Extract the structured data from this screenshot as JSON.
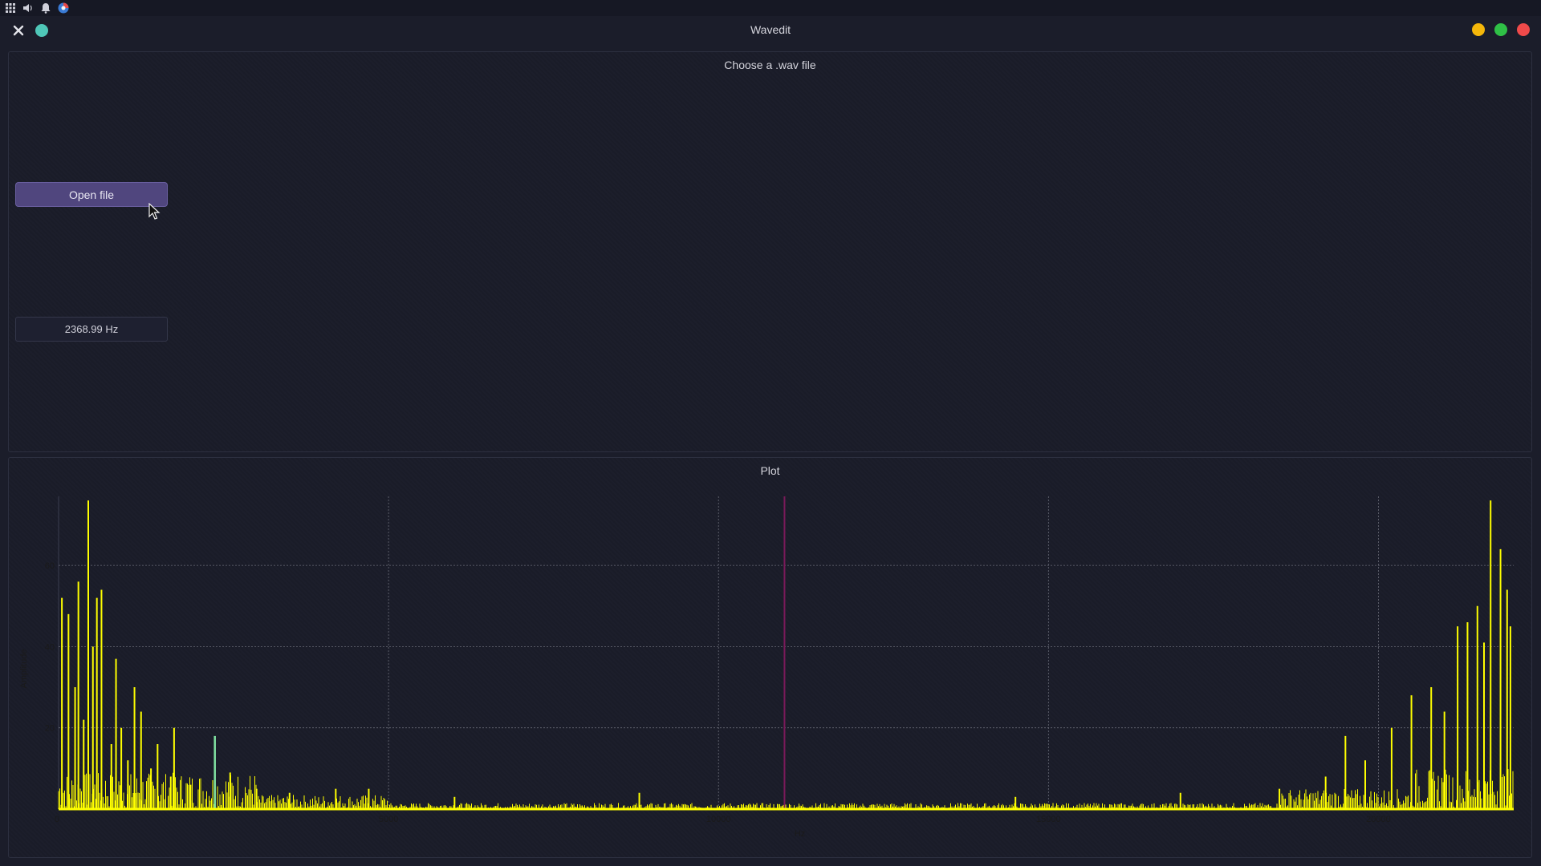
{
  "window": {
    "title": "Wavedit",
    "controls": {
      "minimize_color": "#f5b70a",
      "maximize_color": "#2fc046",
      "close_color": "#f04a4a"
    },
    "left_controls": {
      "close_icon": "close-icon",
      "pin_color": "#4fc7b8"
    }
  },
  "top_panel": {
    "title": "Choose a .wav file",
    "open_button_label": "Open file",
    "frequency_value": "2368.99 Hz"
  },
  "plot_panel": {
    "title": "Plot"
  },
  "colors": {
    "accent_button": "#50467e",
    "series_color": "#ffff00",
    "highlight_color": "#7fe0a0",
    "marker_color": "#7a1a5a"
  },
  "chart_data": {
    "type": "line",
    "title": "",
    "xlabel": "Hz",
    "ylabel": "Amplitude",
    "xlim": [
      0,
      22050
    ],
    "ylim": [
      0,
      77
    ],
    "xticks": [
      0,
      5000,
      10000,
      15000,
      20000
    ],
    "xtick_labels": [
      "0",
      "5000",
      "10000",
      "15000",
      "20000"
    ],
    "yticks": [
      20,
      40,
      60
    ],
    "ytick_labels": [
      "20",
      "40",
      "60"
    ],
    "grid": true,
    "series": [
      {
        "color": "#ffff00",
        "peaks": [
          {
            "x": 50,
            "y": 52
          },
          {
            "x": 150,
            "y": 48
          },
          {
            "x": 250,
            "y": 30
          },
          {
            "x": 300,
            "y": 56
          },
          {
            "x": 380,
            "y": 22
          },
          {
            "x": 450,
            "y": 76
          },
          {
            "x": 520,
            "y": 40
          },
          {
            "x": 580,
            "y": 52
          },
          {
            "x": 650,
            "y": 54
          },
          {
            "x": 800,
            "y": 16
          },
          {
            "x": 870,
            "y": 37
          },
          {
            "x": 950,
            "y": 20
          },
          {
            "x": 1050,
            "y": 12
          },
          {
            "x": 1150,
            "y": 30
          },
          {
            "x": 1250,
            "y": 24
          },
          {
            "x": 1400,
            "y": 10
          },
          {
            "x": 1500,
            "y": 16
          },
          {
            "x": 1700,
            "y": 8
          },
          {
            "x": 1750,
            "y": 20
          },
          {
            "x": 2000,
            "y": 6
          },
          {
            "x": 2368,
            "y": 18
          },
          {
            "x": 2600,
            "y": 9
          },
          {
            "x": 3000,
            "y": 5
          },
          {
            "x": 3500,
            "y": 4
          },
          {
            "x": 4200,
            "y": 5
          },
          {
            "x": 4700,
            "y": 5
          },
          {
            "x": 6000,
            "y": 3
          },
          {
            "x": 8800,
            "y": 4
          },
          {
            "x": 14500,
            "y": 3
          },
          {
            "x": 17000,
            "y": 4
          },
          {
            "x": 18500,
            "y": 5
          },
          {
            "x": 19200,
            "y": 8
          },
          {
            "x": 19500,
            "y": 18
          },
          {
            "x": 19800,
            "y": 12
          },
          {
            "x": 20200,
            "y": 20
          },
          {
            "x": 20500,
            "y": 28
          },
          {
            "x": 20800,
            "y": 30
          },
          {
            "x": 21000,
            "y": 24
          },
          {
            "x": 21200,
            "y": 45
          },
          {
            "x": 21350,
            "y": 46
          },
          {
            "x": 21500,
            "y": 50
          },
          {
            "x": 21600,
            "y": 41
          },
          {
            "x": 21700,
            "y": 76
          },
          {
            "x": 21850,
            "y": 64
          },
          {
            "x": 21950,
            "y": 54
          },
          {
            "x": 22000,
            "y": 45
          }
        ]
      }
    ],
    "highlight_x": 2368.99,
    "marker_x": 11000
  }
}
